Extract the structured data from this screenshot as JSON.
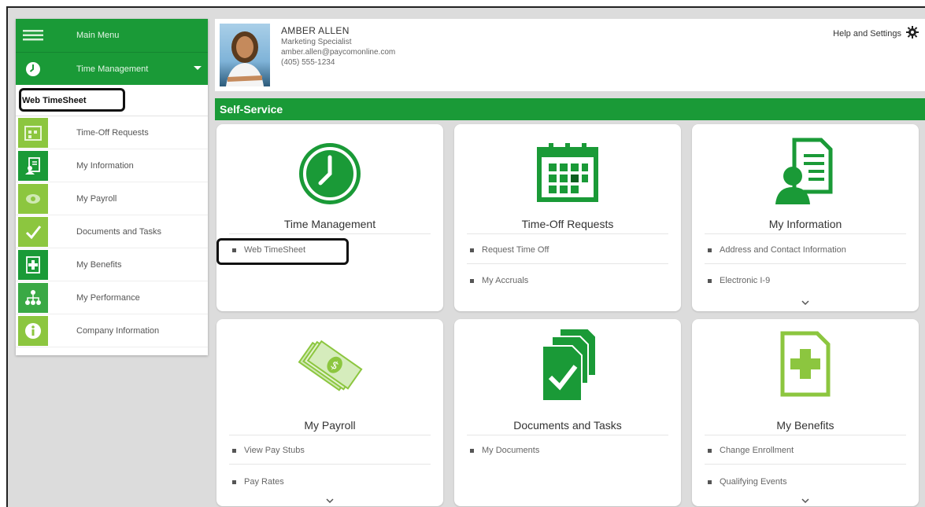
{
  "sidebar": {
    "main_menu": "Main Menu",
    "time_management": "Time Management",
    "web_timesheet": "Web TimeSheet",
    "items": [
      {
        "label": "Time-Off Requests",
        "icon": "calendar-icon"
      },
      {
        "label": "My Information",
        "icon": "profile-document-icon"
      },
      {
        "label": "My Payroll",
        "icon": "money-icon"
      },
      {
        "label": "Documents and Tasks",
        "icon": "checkmark-icon"
      },
      {
        "label": "My Benefits",
        "icon": "medical-plus-icon"
      },
      {
        "label": "My Performance",
        "icon": "org-chart-icon"
      },
      {
        "label": "Company Information",
        "icon": "info-icon"
      }
    ]
  },
  "header": {
    "name": "AMBER ALLEN",
    "title": "Marketing Specialist",
    "email": "amber.allen@paycomonline.com",
    "phone": "(405) 555-1234",
    "help": "Help and Settings"
  },
  "self_service": {
    "label": "Self-Service"
  },
  "cards": [
    {
      "title": "Time Management",
      "links": [
        "Web TimeSheet"
      ],
      "more": false
    },
    {
      "title": "Time-Off Requests",
      "links": [
        "Request Time Off",
        "My Accruals"
      ],
      "more": false
    },
    {
      "title": "My Information",
      "links": [
        "Address and Contact Information",
        "Electronic I-9"
      ],
      "more": true
    },
    {
      "title": "My Payroll",
      "links": [
        "View Pay Stubs",
        "Pay Rates"
      ],
      "more": true
    },
    {
      "title": "Documents and Tasks",
      "links": [
        "My Documents"
      ],
      "more": false
    },
    {
      "title": "My Benefits",
      "links": [
        "Change Enrollment",
        "Qualifying Events"
      ],
      "more": true
    }
  ],
  "colors": {
    "brand_green": "#1a9a37",
    "light_green": "#8cc63f"
  }
}
